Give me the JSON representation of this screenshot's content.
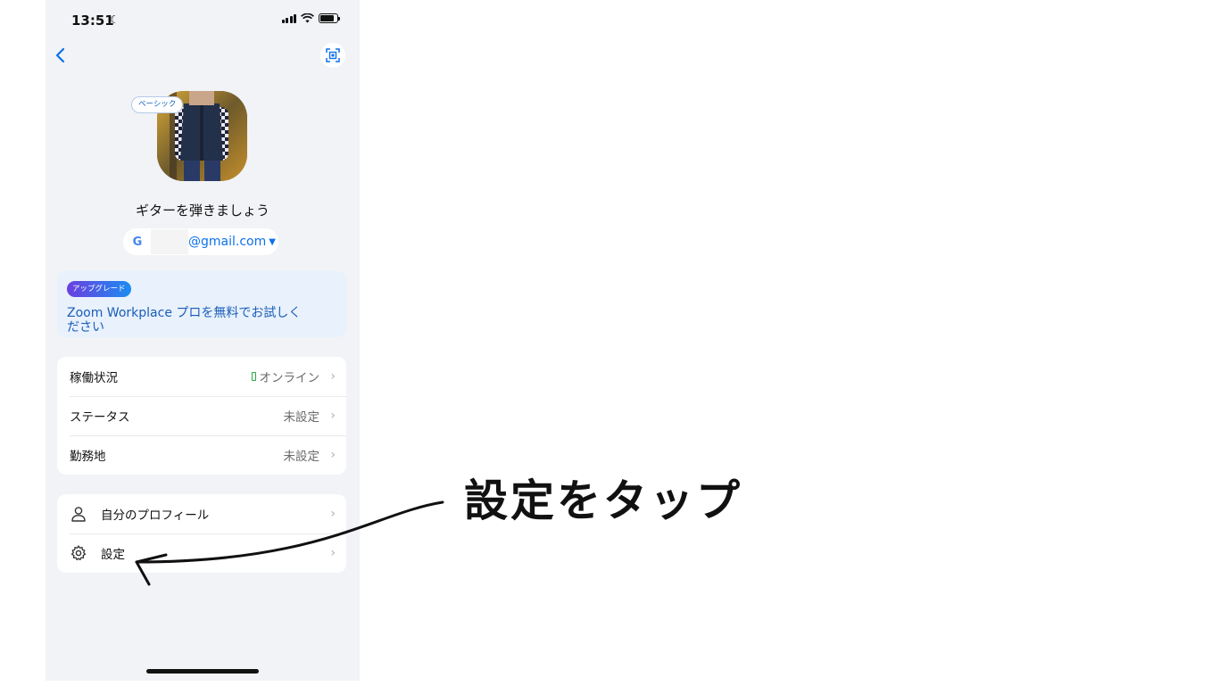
{
  "status_bar": {
    "time": "13:51"
  },
  "profile": {
    "plan_badge": "ベーシック",
    "display_name": "ギターを弾きましょう",
    "account_email": "@gmail.com",
    "account_provider_glyph": "G"
  },
  "upgrade": {
    "tag": "アップグレード",
    "text": "Zoom Workplace プロを無料でお試しください"
  },
  "status_card": [
    {
      "label": "稼働状況",
      "value": "オンライン"
    },
    {
      "label": "ステータス",
      "value": "未設定"
    },
    {
      "label": "勤務地",
      "value": "未設定"
    }
  ],
  "menu_card": [
    {
      "label": "自分のプロフィール",
      "icon": "person-icon"
    },
    {
      "label": "設定",
      "icon": "gear-icon"
    }
  ],
  "annotation": {
    "text": "設定をタップ"
  },
  "colors": {
    "accent": "#0e71eb",
    "online": "#27a843",
    "background": "#f1f3f6"
  }
}
